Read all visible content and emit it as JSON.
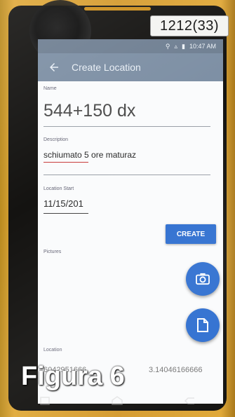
{
  "sticker": "1212(33)",
  "status_bar": {
    "time": "10:47 AM"
  },
  "app_bar": {
    "title": "Create Location"
  },
  "form": {
    "name_label": "Name",
    "name_value": "544+150 dx",
    "description_label": "Description",
    "description_value": "schiumato 5 ore maturaz",
    "start_label": "Location Start",
    "start_value": "11/15/201",
    "create_label": "CREATE",
    "pictures_label": "Pictures",
    "location_label": "Location",
    "location_value_left": "6042951666",
    "location_value_right": "3.14046166666"
  },
  "caption": "Figura 6",
  "colors": {
    "accent": "#2f6fd0",
    "appbar": "#7d8fa4",
    "phone_body": "#d49a2e"
  },
  "icons": [
    "arrow-back-icon",
    "camera-icon",
    "document-icon",
    "back-nav-icon",
    "home-nav-icon",
    "recents-nav-icon"
  ]
}
